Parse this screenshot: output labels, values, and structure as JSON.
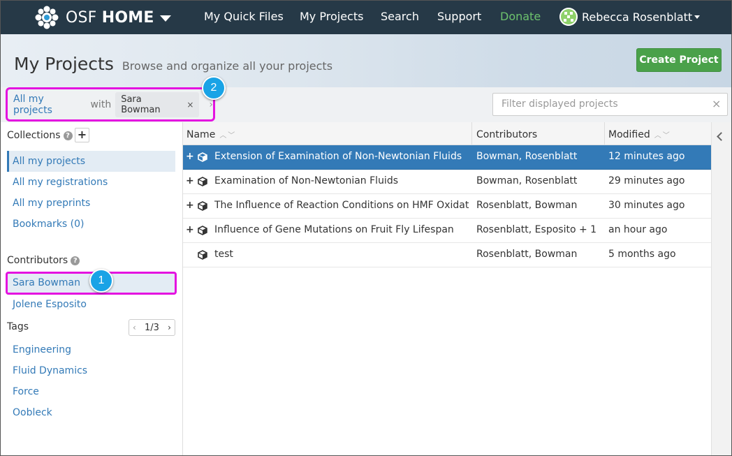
{
  "nav": {
    "brand_plain": "OSF ",
    "brand_bold": "HOME",
    "links": [
      "My Quick Files",
      "My Projects",
      "Search",
      "Support",
      "Donate"
    ],
    "user_name": "Rebecca Rosenblatt",
    "donate_color": "#6dc26d"
  },
  "header": {
    "title": "My Projects",
    "subtitle": "Browse and organize all your projects",
    "create_button": "Create Project"
  },
  "filterbar": {
    "breadcrumb_root": "All my projects",
    "with_label": "with",
    "chip_label": "Sara Bowman",
    "chip_close": "×",
    "arrow": "›",
    "filter_placeholder": "Filter displayed projects",
    "clear_icon": "×"
  },
  "callouts": {
    "one": "1",
    "two": "2",
    "color": "#19a3e6",
    "highlight_color": "#e413e0"
  },
  "sidebar": {
    "collections_heading": "Collections",
    "help_glyph": "?",
    "add_glyph": "+",
    "collections": [
      "All my projects",
      "All my registrations",
      "All my preprints",
      "Bookmarks (0)"
    ],
    "contributors_heading": "Contributors",
    "contributors": [
      "Sara Bowman",
      "Jolene Esposito"
    ],
    "tags_heading": "Tags",
    "tags_page": "1/3",
    "tags": [
      "Engineering",
      "Fluid Dynamics",
      "Force",
      "Oobleck"
    ]
  },
  "grid": {
    "columns": {
      "name": "Name",
      "contributors": "Contributors",
      "modified": "Modified"
    },
    "rows": [
      {
        "toggle": "+",
        "name": "Extension of Examination of Non-Newtonian Fluids",
        "contributors": "Bowman, Rosenblatt",
        "modified": "12 minutes ago",
        "selected": true
      },
      {
        "toggle": "+",
        "name": "Examination of Non-Newtonian Fluids",
        "contributors": "Bowman, Rosenblatt",
        "modified": "29 minutes ago",
        "selected": false
      },
      {
        "toggle": "+",
        "name": "The Influence of Reaction Conditions on HMF Oxidatio...",
        "contributors": "Rosenblatt, Bowman",
        "modified": "30 minutes ago",
        "selected": false
      },
      {
        "toggle": "+",
        "name": "Influence of Gene Mutations on Fruit Fly Lifespan",
        "contributors": "Rosenblatt, Esposito + 1",
        "modified": "an hour ago",
        "selected": false
      },
      {
        "toggle": "",
        "name": "test",
        "contributors": "Rosenblatt, Bowman",
        "modified": "5 months ago",
        "selected": false
      }
    ]
  }
}
